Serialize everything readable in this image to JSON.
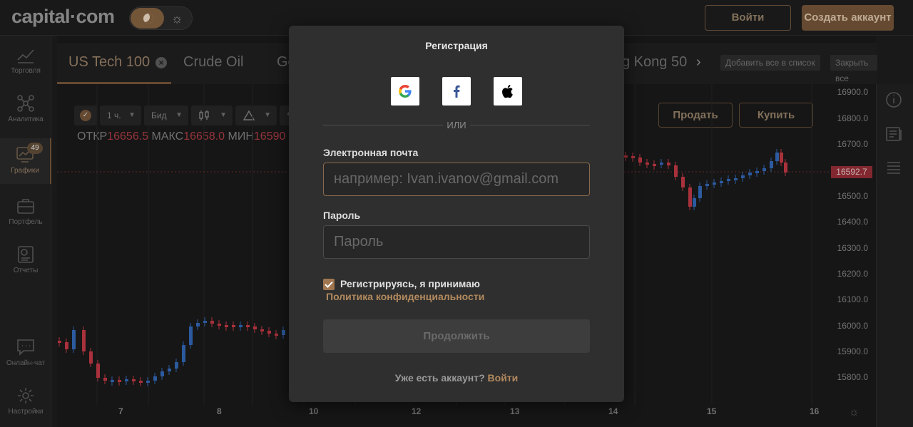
{
  "header": {
    "logo": "capital·com",
    "login_label": "Войти",
    "create_label": "Создать аккаунт"
  },
  "sidebar": {
    "items": [
      {
        "label": "Торговля",
        "icon": "chart-line-icon"
      },
      {
        "label": "Аналитика",
        "icon": "network-icon"
      },
      {
        "label": "Графики",
        "icon": "chart-candles-icon",
        "badge": "49"
      },
      {
        "label": "Портфель",
        "icon": "briefcase-icon"
      },
      {
        "label": "Отчеты",
        "icon": "report-icon"
      },
      {
        "label": "Онлайн-чат",
        "icon": "chat-icon"
      },
      {
        "label": "Настройки",
        "icon": "gear-icon"
      }
    ]
  },
  "tabs": {
    "items": [
      "US Tech 100",
      "Crude Oil",
      "Ge",
      "g Kong 50"
    ],
    "add_all": "Добавить все в список",
    "close_all": "Закрыть все"
  },
  "toolbar": {
    "interval": "1 ч.",
    "price_type": "Бид"
  },
  "ohlc": {
    "open_label": "ОТКР",
    "open_value": "16656.5",
    "high_label": "МАКС",
    "high_value": "16658.0",
    "low_label": "МИН",
    "low_value": "16590"
  },
  "trade": {
    "sell_label": "Продать",
    "buy_label": "Купить"
  },
  "axis": {
    "y_ticks": [
      "16900.0",
      "16800.0",
      "16700.0",
      "16500.0",
      "16400.0",
      "16300.0",
      "16200.0",
      "16100.0",
      "16000.0",
      "15900.0",
      "15800.0"
    ],
    "current_price": "16592.7",
    "x_ticks": [
      "7",
      "8",
      "10",
      "12",
      "13",
      "14",
      "15",
      "16"
    ]
  },
  "modal": {
    "title": "Регистрация",
    "or": "ИЛИ",
    "email_label": "Электронная почта",
    "email_placeholder": "например: Ivan.ivanov@gmail.com",
    "password_label": "Пароль",
    "password_placeholder": "Пароль",
    "consent_text": "Регистрируясь, я принимаю",
    "policy_link": "Политика конфиденциальности",
    "continue_label": "Продолжить",
    "have_account_text": "Уже есть аккаунт?",
    "have_account_link": "Войти"
  },
  "colors": {
    "accent": "#6b4f34",
    "accent_text": "#b38a5e",
    "down_candle": "#b3343f",
    "up_candle": "#2f5fa8"
  }
}
